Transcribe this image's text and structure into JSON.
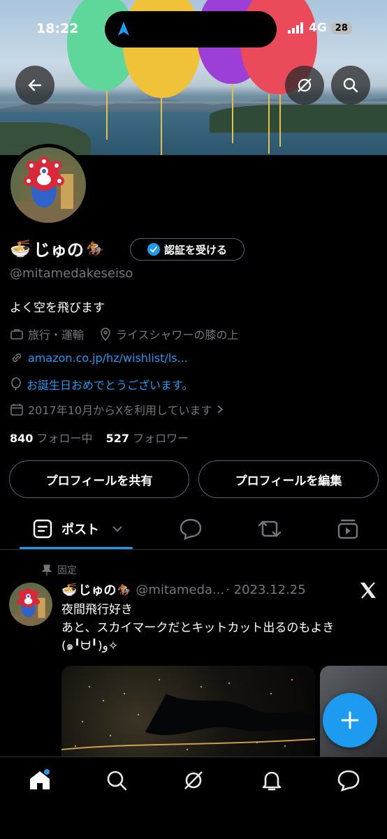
{
  "status_bar": {
    "time": "18:22",
    "network": "4G",
    "battery": "28"
  },
  "profile": {
    "display_name": "じゅの",
    "name_prefix_emoji": "🍜",
    "name_suffix_emoji": "🏇",
    "verify_button": "認証を受ける",
    "handle": "@mitamedakeseiso",
    "bio": "よく空を飛びます",
    "category": "旅行・運輸",
    "location": "ライスシャワーの膝の上",
    "website": "amazon.co.jp/hz/wishlist/ls...",
    "birthday": "お誕生日おめでとうございます。",
    "joined": "2017年10月からXを利用しています",
    "following_count": "840",
    "following_label": "フォロー中",
    "followers_count": "527",
    "followers_label": "フォロワー"
  },
  "actions": {
    "share": "プロフィールを共有",
    "edit": "プロフィールを編集"
  },
  "tabs": {
    "posts": "ポスト"
  },
  "pinned_post": {
    "pinned_label": "固定",
    "author": "じゅの",
    "author_prefix_emoji": "🍜",
    "author_suffix_emoji": "🏇",
    "handle": "@mitameda...",
    "date": "· 2023.12.25",
    "text_line1": "夜間飛行好き",
    "text_line2": "あと、スカイマークだとキットカット出るのもよき(๑╹ᗨ╹)و✧"
  },
  "colors": {
    "accent": "#1d9bf0",
    "muted": "#71767b",
    "border": "#536471"
  }
}
